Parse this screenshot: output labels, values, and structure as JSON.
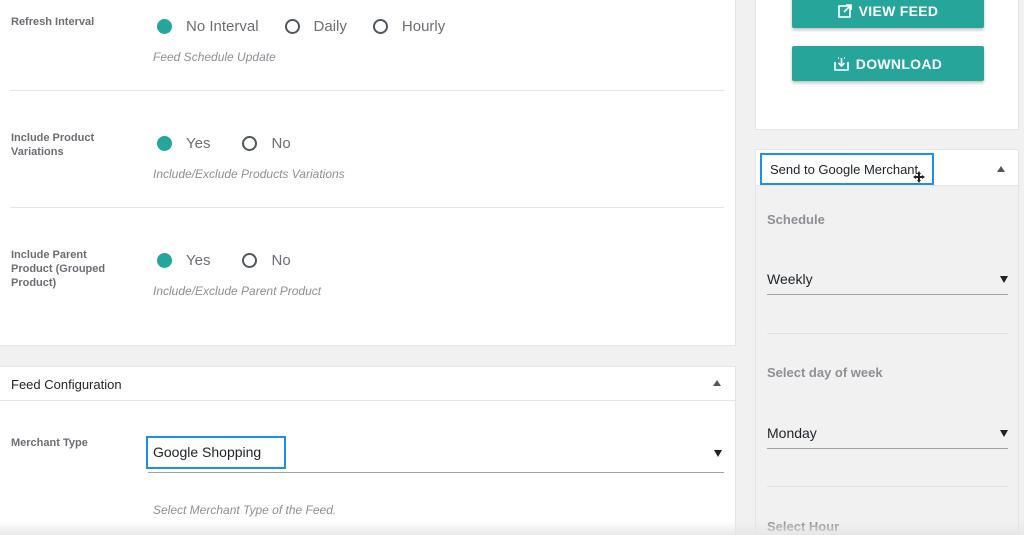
{
  "settings": {
    "refresh": {
      "label": "Refresh Interval",
      "options": [
        "No Interval",
        "Daily",
        "Hourly"
      ],
      "help": "Feed Schedule Update"
    },
    "variations": {
      "label": "Include Product Variations",
      "options": [
        "Yes",
        "No"
      ],
      "help": "Include/Exclude Products Variations"
    },
    "parent": {
      "label": "Include Parent Product (Grouped Product)",
      "options": [
        "Yes",
        "No"
      ],
      "help": "Include/Exclude Parent Product"
    }
  },
  "feed_config": {
    "title": "Feed Configuration",
    "merchant_label": "Merchant Type",
    "merchant_value": "Google Shopping",
    "help": "Select Merchant Type of the Feed."
  },
  "sidebar": {
    "view_feed": "VIEW FEED",
    "download": "DOWNLOAD",
    "merchant_panel": {
      "title": "Send to Google Merchant",
      "schedule_label": "Schedule",
      "schedule_value": "Weekly",
      "day_label": "Select day of week",
      "day_value": "Monday",
      "hour_label": "Select Hour"
    }
  },
  "colors": {
    "accent": "#26a69a",
    "highlight": "#1e90e8"
  }
}
